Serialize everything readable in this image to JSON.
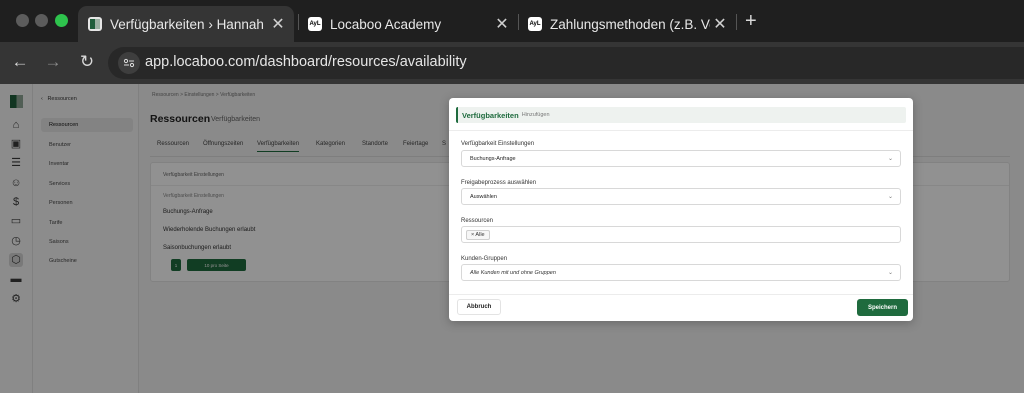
{
  "browser": {
    "tabs": [
      {
        "title": "Verfügbarkeiten › Hannah Sch",
        "active": true,
        "favicon": "locaboo-app-favicon"
      },
      {
        "title": "Locaboo Academy",
        "active": false,
        "favicon": "AyL"
      },
      {
        "title": "Zahlungsmethoden (z.B. Vork",
        "active": false,
        "favicon": "AyL"
      }
    ],
    "close_glyph": "✕",
    "new_tab_glyph": "+",
    "url": "app.locaboo.com/dashboard/resources/availability"
  },
  "app": {
    "submenu": {
      "header": "Ressourcen",
      "items": [
        "Ressourcen",
        "Benutzer",
        "Inventar",
        "Services",
        "Personen",
        "Tarife",
        "Saisons",
        "Gutscheine"
      ],
      "active_index": 0
    },
    "breadcrumb": "Ressourcen  >  Einstellungen  >  Verfügbarkeiten",
    "page_title": "Ressourcen",
    "page_subtitle": "Verfügbarkeiten",
    "tabs": [
      "Ressourcen",
      "Öffnungszeiten",
      "Verfügbarkeiten",
      "Kategorien",
      "Standorte",
      "Feiertage",
      "S"
    ],
    "active_tab_index": 2,
    "card": {
      "header": "Verfügbarkeit Einstellungen",
      "subheader": "Verfügbarkeit Einstellungen",
      "rows": [
        "Buchungs-Anfrage",
        "Wiederholende Buchungen erlaubt",
        "Saisonbuchungen erlaubt"
      ],
      "page_number": "1",
      "page_size": "10 pro Seite"
    }
  },
  "modal": {
    "title": "Verfügbarkeiten",
    "subtitle": "Hinzufügen",
    "fields": [
      {
        "label": "Verfügbarkeit Einstellungen",
        "value": "Buchungs-Anfrage"
      },
      {
        "label": "Freigabeprozess auswählen",
        "value": "Auswählen"
      },
      {
        "label": "Ressourcen",
        "chip": "× Alle"
      },
      {
        "label": "Kunden-Gruppen",
        "value": "Alle Kunden mit und ohne Gruppen"
      }
    ],
    "cancel_label": "Abbruch",
    "save_label": "Speichern"
  },
  "colors": {
    "brand_green": "#1f6b3e",
    "overlay": "rgba(0,0,0,0.43)"
  }
}
